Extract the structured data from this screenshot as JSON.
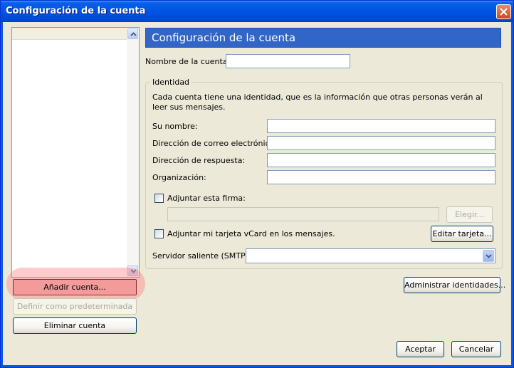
{
  "window": {
    "title": "Configuración de la cuenta"
  },
  "sidebar": {
    "buttons": {
      "add": "Añadir cuenta...",
      "set_default": "Definir como predeterminada",
      "remove": "Eliminar cuenta"
    }
  },
  "main": {
    "header": "Configuración de la cuenta",
    "account_name_label": "Nombre de la cuenta:",
    "account_name_value": "",
    "identity": {
      "legend": "Identidad",
      "description": "Cada cuenta tiene una identidad, que es la información que otras personas verán al leer sus mensajes.",
      "fields": [
        {
          "label": "Su nombre:",
          "value": ""
        },
        {
          "label": "Dirección de correo electrónico:",
          "value": ""
        },
        {
          "label": "Dirección de respuesta:",
          "value": ""
        },
        {
          "label": "Organización:",
          "value": ""
        }
      ],
      "attach_signature_label": "Adjuntar esta firma:",
      "signature_path": "",
      "choose_button": "Elegir...",
      "attach_vcard_label": "Adjuntar mi tarjeta vCard en los mensajes.",
      "edit_card_button": "Editar tarjeta...",
      "smtp_label": "Servidor saliente (SMTP):",
      "smtp_value": ""
    },
    "manage_identities_button": "Administrar identidades..."
  },
  "footer": {
    "accept": "Aceptar",
    "cancel": "Cancelar"
  },
  "colors": {
    "titlebar": "#0054e3",
    "header_bar": "#3165c8",
    "dialog_bg": "#ece9d8",
    "highlight": "#f39a9a"
  }
}
